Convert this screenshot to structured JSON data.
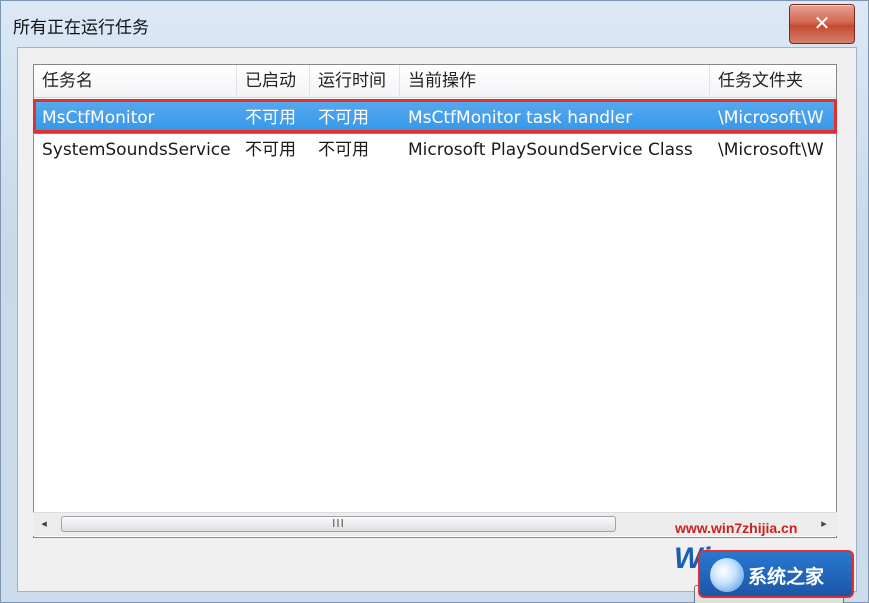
{
  "window": {
    "title": "所有正在运行任务",
    "close_label": "✕"
  },
  "table": {
    "columns": [
      "任务名",
      "已启动",
      "运行时间",
      "当前操作",
      "任务文件夹"
    ],
    "rows": [
      [
        "MsCtfMonitor",
        "不可用",
        "不可用",
        "MsCtfMonitor task handler",
        "\\Microsoft\\W"
      ],
      [
        "SystemSoundsService",
        "不可用",
        "不可用",
        "Microsoft PlaySoundService Class",
        "\\Microsoft\\W"
      ]
    ],
    "selected_row": 0
  },
  "scrollbar": {
    "left_arrow": "◂",
    "right_arrow": "▸",
    "thumb_grip": "III"
  },
  "watermark": {
    "url": "www.win7zhijia.cn",
    "logo_win": "Win",
    "logo_text": "系统之家"
  },
  "colors": {
    "selection": "#3396e8",
    "highlight_border": "#e03030",
    "close_button": "#c44a30"
  }
}
